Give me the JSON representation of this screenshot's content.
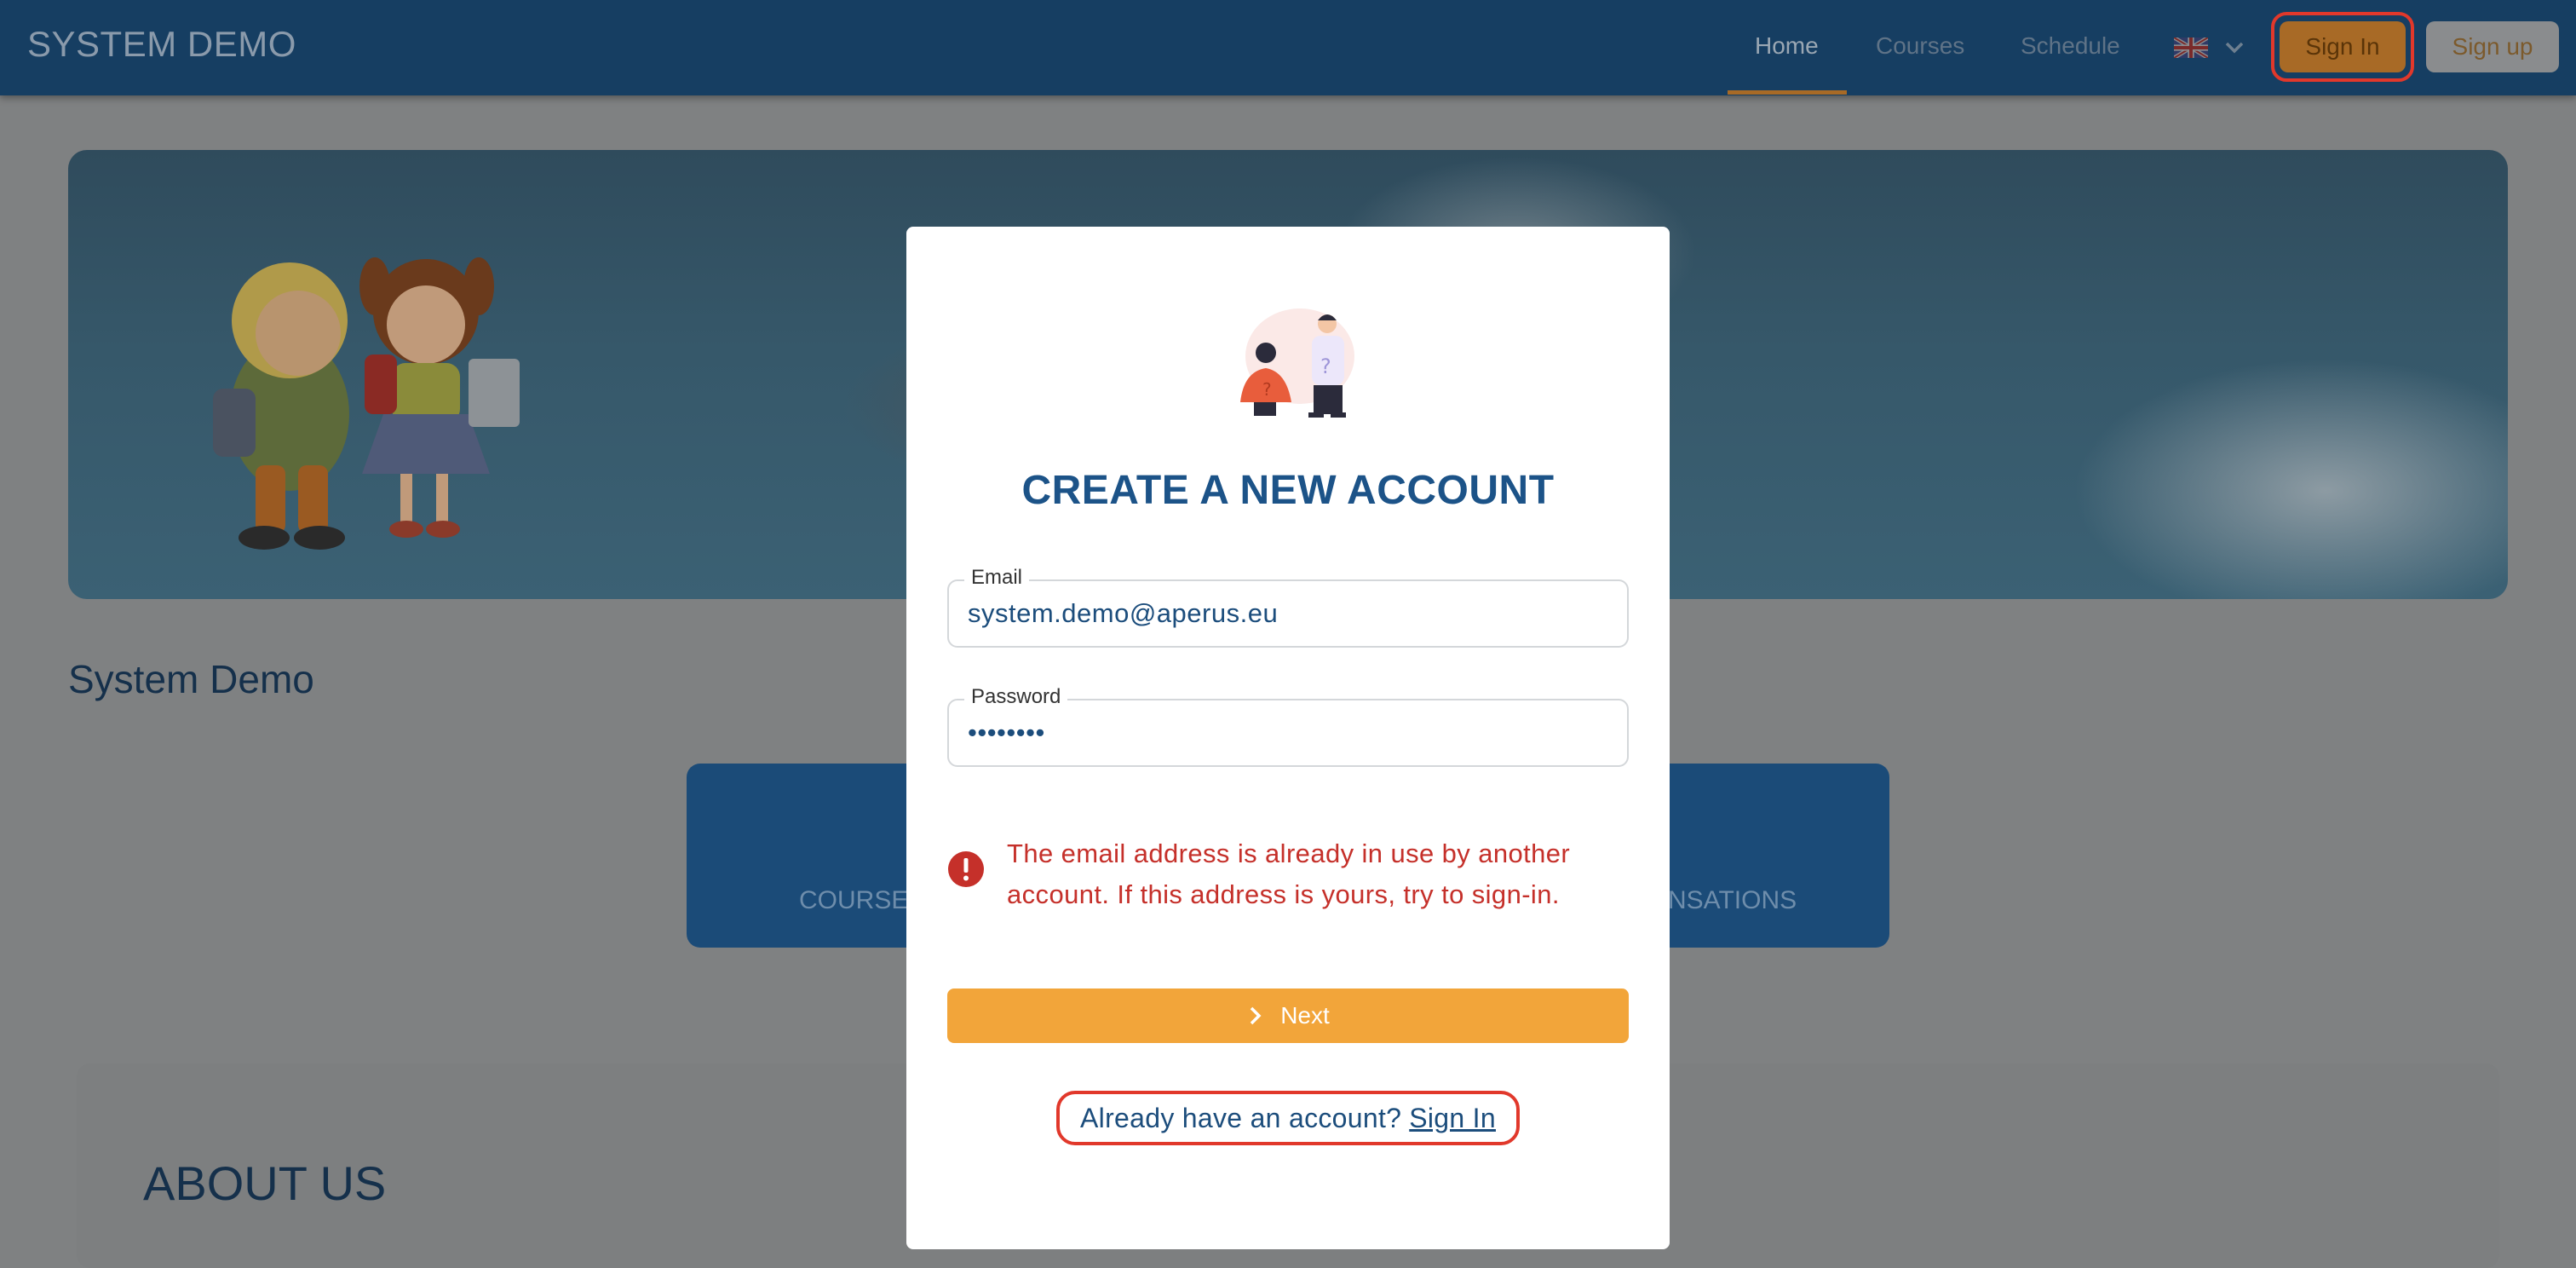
{
  "header": {
    "brand": "SYSTEM DEMO",
    "nav": [
      {
        "label": "Home",
        "active": true
      },
      {
        "label": "Courses",
        "active": false
      },
      {
        "label": "Schedule",
        "active": false
      }
    ],
    "language_icon": "uk-flag-icon",
    "sign_in_label": "Sign In",
    "sign_up_label": "Sign up"
  },
  "page": {
    "title": "System Demo",
    "stats": [
      "COURSES",
      "NSATIONS"
    ],
    "about_title": "ABOUT US"
  },
  "modal": {
    "title": "CREATE A NEW ACCOUNT",
    "email": {
      "label": "Email",
      "value": "system.demo@aperus.eu"
    },
    "password": {
      "label": "Password",
      "value": "••••••••"
    },
    "error_text": "The email address is already in use by another account. If this address is yours, try to sign-in.",
    "next_label": "Next",
    "already_text": "Already have an account?",
    "sign_in_link": "Sign In"
  },
  "colors": {
    "navbar": "#163e62",
    "primary": "#1c5388",
    "accent": "#f2a53a",
    "error": "#c5302a",
    "highlight_ring": "#e1382b"
  }
}
